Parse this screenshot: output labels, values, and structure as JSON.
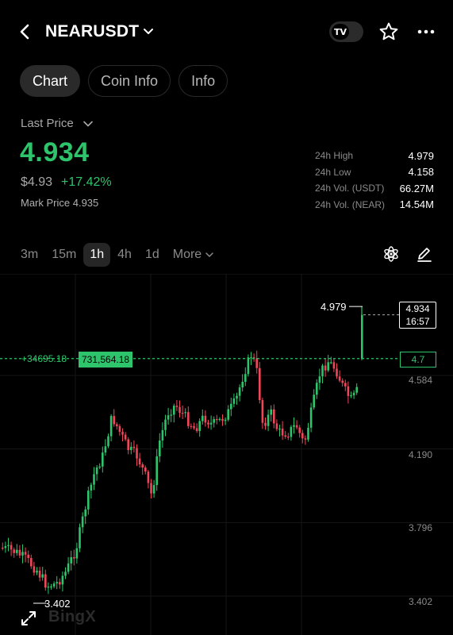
{
  "header": {
    "pair": "NEARUSDT",
    "tv_label": "TV"
  },
  "tabs": [
    {
      "label": "Chart",
      "active": true
    },
    {
      "label": "Coin Info",
      "active": false
    },
    {
      "label": "Info",
      "active": false
    }
  ],
  "price": {
    "last_label": "Last Price",
    "last_value": "4.934",
    "usd_value": "$4.93",
    "change_pct": "+17.42%",
    "mark_price": "Mark Price 4.935"
  },
  "stats": [
    {
      "label": "24h High",
      "value": "4.979"
    },
    {
      "label": "24h Low",
      "value": "4.158"
    },
    {
      "label": "24h Vol. (USDT)",
      "value": "66.27M"
    },
    {
      "label": "24h Vol. (NEAR)",
      "value": "14.54M"
    }
  ],
  "intervals": [
    {
      "label": "3m",
      "active": false
    },
    {
      "label": "15m",
      "active": false
    },
    {
      "label": "1h",
      "active": true
    },
    {
      "label": "4h",
      "active": false
    },
    {
      "label": "1d",
      "active": false
    }
  ],
  "more_label": "More",
  "chart": {
    "high_label": "4.979",
    "low_label": "3.402",
    "current_price": "4.934",
    "countdown": "16:57",
    "position_line_price": "4.7",
    "pnl": "+34695.18",
    "quantity": "731,564.18",
    "y_ticks": [
      "4.584",
      "4.190",
      "3.796",
      "3.402"
    ],
    "watermark": "BingX"
  },
  "chart_data": {
    "type": "candlestick",
    "y_axis_ticks": [
      4.584,
      4.19,
      3.796,
      3.402
    ],
    "high": 4.979,
    "low": 3.402,
    "last": 4.934,
    "position_price": 4.7,
    "up_color": "#2ec46b",
    "down_color": "#f0465a"
  },
  "colors": {
    "accent_green": "#2ec46b",
    "down_red": "#f0465a",
    "background": "#000000"
  }
}
